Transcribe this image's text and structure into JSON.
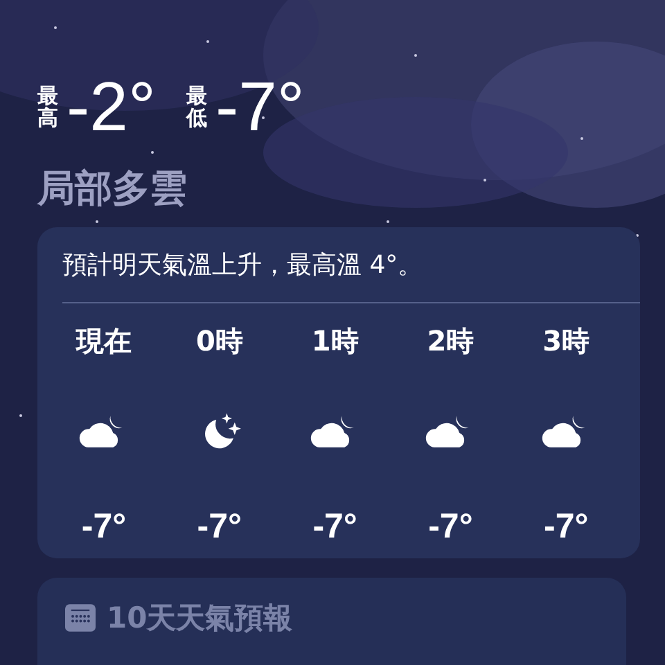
{
  "high": {
    "label": "最高",
    "value": "-2°"
  },
  "low": {
    "label": "最低",
    "value": "-7°"
  },
  "condition": "局部多雲",
  "hourly_card": {
    "summary": "預計明天氣溫上升，最高溫 4°。",
    "hours": [
      {
        "label": "現在",
        "kind": "cloudy",
        "temp": "-7°"
      },
      {
        "label": "0時",
        "kind": "clear",
        "temp": "-7°"
      },
      {
        "label": "1時",
        "kind": "cloudy",
        "temp": "-7°"
      },
      {
        "label": "2時",
        "kind": "cloudy",
        "temp": "-7°"
      },
      {
        "label": "3時",
        "kind": "cloudy",
        "temp": "-7°"
      }
    ]
  },
  "forecast_card": {
    "title": "10天天氣預報"
  }
}
